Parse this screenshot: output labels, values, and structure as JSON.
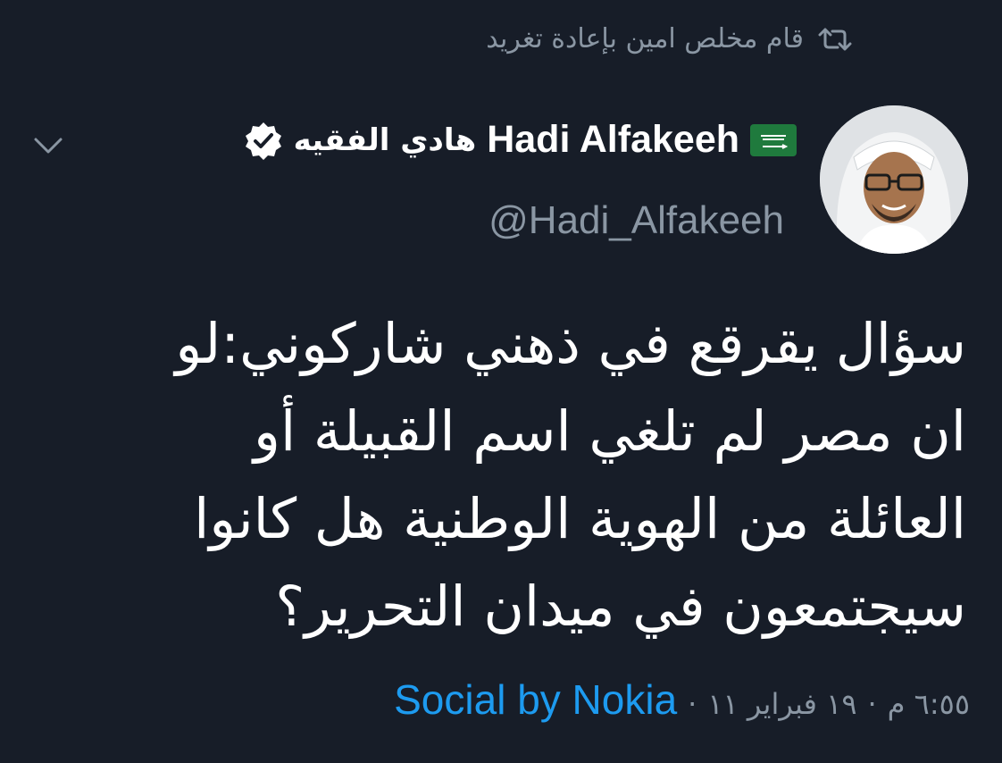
{
  "retweet": {
    "text": "قام مخلص امين بإعادة تغريد",
    "icon": "retweet-icon"
  },
  "author": {
    "name_latin": "Hadi Alfakeeh",
    "name_arabic": "هادي الفقيه",
    "handle": "@Hadi_Alfakeeh",
    "flag_icon": "saudi-flag-icon",
    "verified_icon": "verified-badge-icon",
    "avatar": "avatar"
  },
  "menu": {
    "icon": "chevron-down-icon"
  },
  "tweet": {
    "text": "سؤال يقرقع في ذهني شاركوني:لو\nان مصر لم تلغي اسم القبيلة أو\nالعائلة من الهوية الوطنية هل كانوا\nسيجتمعون في ميدان التحرير؟"
  },
  "meta": {
    "time": "٦:٥٥ م",
    "date": "١٩ فبراير ١١",
    "separator": "·",
    "source": "Social by Nokia"
  },
  "colors": {
    "background": "#171d28",
    "muted": "#8a96a3",
    "link": "#1d9bf0",
    "text": "#ffffff",
    "flag_green": "#1f7a3d"
  }
}
